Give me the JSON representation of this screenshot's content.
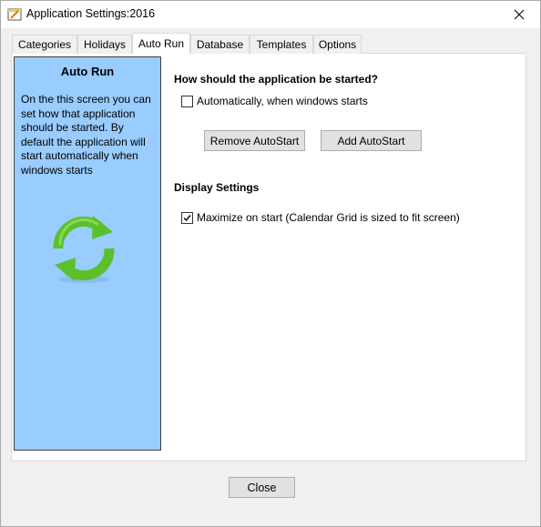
{
  "window": {
    "title": "Application Settings:2016"
  },
  "tabs": [
    {
      "label": "Categories"
    },
    {
      "label": "Holidays"
    },
    {
      "label": "Auto Run"
    },
    {
      "label": "Database"
    },
    {
      "label": "Templates"
    },
    {
      "label": "Options"
    }
  ],
  "active_tab": "Auto Run",
  "side_panel": {
    "title": "Auto Run",
    "description": "On the this screen you can set how that application should be started. By default the application will start automatically when windows starts",
    "icon": "refresh-icon"
  },
  "startup": {
    "heading": "How should the application be started?",
    "auto_start_label": "Automatically, when windows starts",
    "auto_start_checked": false,
    "remove_button": "Remove AutoStart",
    "add_button": "Add AutoStart"
  },
  "display": {
    "heading": "Display Settings",
    "maximize_label": "Maximize on start (Calendar Grid is sized to fit screen)",
    "maximize_checked": true
  },
  "footer": {
    "close_button": "Close"
  },
  "colors": {
    "side_panel_bg": "#99ccff",
    "icon_green": "#5cc02a"
  }
}
